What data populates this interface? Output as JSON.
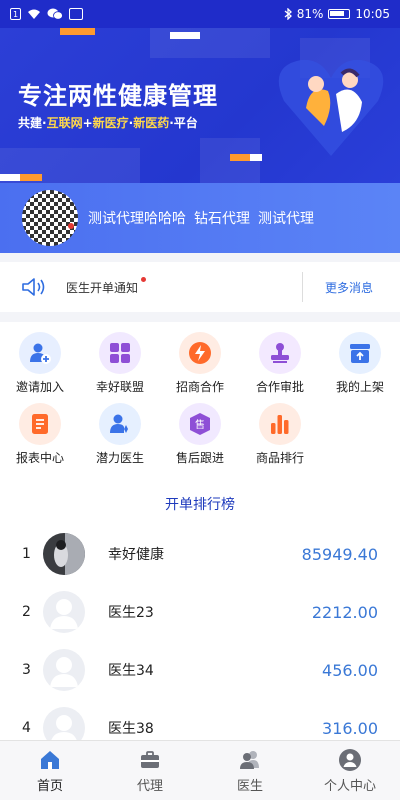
{
  "status": {
    "battery": "81%",
    "time": "10:05"
  },
  "banner": {
    "title": "专注两性健康管理",
    "sub_prefix": "共建·",
    "sub_hl1": "互联网",
    "sub_mid1": "+",
    "sub_hl2": "新医疗",
    "sub_mid2": "·",
    "sub_hl3": "新医药",
    "sub_suffix": "·平台"
  },
  "profile": {
    "name": "测试代理哈哈哈",
    "level": "钻石代理",
    "role": "测试代理"
  },
  "notice": {
    "text": "医生开单通知",
    "more": "更多消息"
  },
  "grid": [
    {
      "label": "邀请加入",
      "icon": "invite-user-icon",
      "bg": "#e7efff",
      "fg": "#3b73e8"
    },
    {
      "label": "幸好联盟",
      "icon": "alliance-grid-icon",
      "bg": "#f1e9ff",
      "fg": "#8e4fd6"
    },
    {
      "label": "招商合作",
      "icon": "lightning-icon",
      "bg": "#ffece3",
      "fg": "#ff6a2a"
    },
    {
      "label": "合作审批",
      "icon": "stamp-icon",
      "bg": "#f3e9ff",
      "fg": "#8e4fd6"
    },
    {
      "label": "我的上架",
      "icon": "shelf-upload-icon",
      "bg": "#e6f0ff",
      "fg": "#3b73e8"
    },
    {
      "label": "报表中心",
      "icon": "report-icon",
      "bg": "#ffece3",
      "fg": "#ff6a2a"
    },
    {
      "label": "潜力医生",
      "icon": "doctor-star-icon",
      "bg": "#e6f0ff",
      "fg": "#3b73e8"
    },
    {
      "label": "售后跟进",
      "icon": "after-sale-icon",
      "bg": "#f1e9ff",
      "fg": "#8e4fd6"
    },
    {
      "label": "商品排行",
      "icon": "bar-ranking-icon",
      "bg": "#ffece3",
      "fg": "#ff6a2a"
    }
  ],
  "ranking": {
    "title": "开单排行榜",
    "rows": [
      {
        "rank": "1",
        "name": "幸好健康",
        "value": "85949.40"
      },
      {
        "rank": "2",
        "name": "医生23",
        "value": "2212.00"
      },
      {
        "rank": "3",
        "name": "医生34",
        "value": "456.00"
      },
      {
        "rank": "4",
        "name": "医生38",
        "value": "316.00"
      }
    ]
  },
  "tabs": [
    {
      "label": "首页",
      "icon": "home-icon",
      "active": true
    },
    {
      "label": "代理",
      "icon": "briefcase-icon",
      "active": false
    },
    {
      "label": "医生",
      "icon": "doctors-icon",
      "active": false
    },
    {
      "label": "个人中心",
      "icon": "profile-icon",
      "active": false
    }
  ],
  "colors": {
    "brand_blue": "#2437cf",
    "accent_blue": "#3a78d6",
    "orange": "#ff6a2a"
  }
}
